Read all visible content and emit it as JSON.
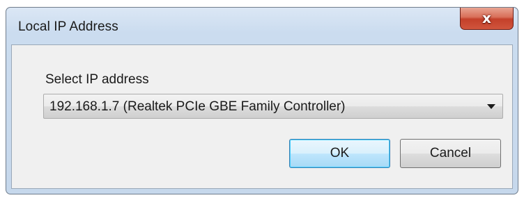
{
  "window": {
    "title": "Local IP Address",
    "close_glyph": "x"
  },
  "form": {
    "select_label": "Select IP address",
    "selected_ip": "192.168.1.7 (Realtek PCIe GBE Family Controller)"
  },
  "buttons": {
    "ok_label": "OK",
    "cancel_label": "Cancel"
  },
  "icons": {
    "close": "close-icon",
    "dropdown": "chevron-down-icon"
  },
  "colors": {
    "close_button": "#c4402a",
    "ok_button_border": "#3c7fb1",
    "client_background": "#f0f0f0"
  }
}
